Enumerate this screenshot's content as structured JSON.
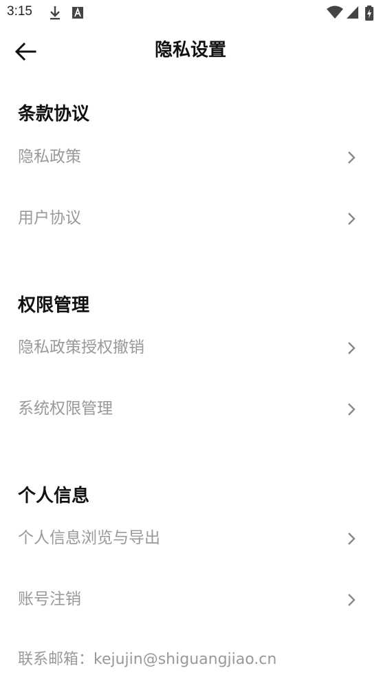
{
  "status_bar": {
    "time": "3:15",
    "icons": [
      "download-icon",
      "a-icon",
      "wifi-icon",
      "signal-icon",
      "battery-icon"
    ]
  },
  "app_bar": {
    "title": "隐私设置",
    "back_icon": "arrow-left-icon"
  },
  "sections": [
    {
      "title": "条款协议",
      "items": [
        {
          "label": "隐私政策"
        },
        {
          "label": "用户协议"
        }
      ]
    },
    {
      "title": "权限管理",
      "items": [
        {
          "label": "隐私政策授权撤销"
        },
        {
          "label": "系统权限管理"
        }
      ]
    },
    {
      "title": "个人信息",
      "items": [
        {
          "label": "个人信息浏览与导出"
        },
        {
          "label": "账号注销"
        }
      ]
    }
  ],
  "contact": "联系邮箱：kejujin@shiguangjiao.cn",
  "colors": {
    "text_primary": "#111111",
    "text_secondary": "#999999",
    "chevron": "#888888",
    "background": "#ffffff"
  }
}
